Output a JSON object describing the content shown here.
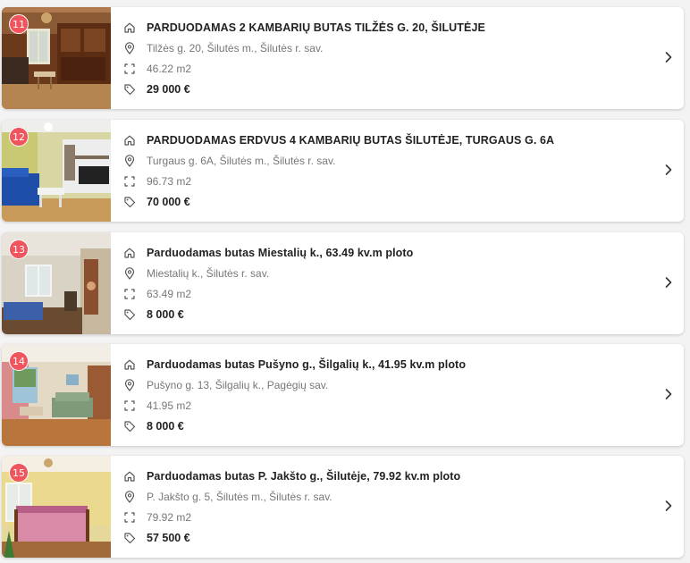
{
  "listings": [
    {
      "number": "11",
      "title": "PARDUODAMAS 2 KAMBARIŲ BUTAS TILŽĖS G. 20, ŠILUTĖJE",
      "address": "Tilžės g. 20, Šilutės m., Šilutės r. sav.",
      "area": "46.22 m2",
      "price": "29 000  €"
    },
    {
      "number": "12",
      "title": "PARDUODAMAS ERDVUS 4 KAMBARIŲ BUTAS ŠILUTĖJE, TURGAUS G. 6A",
      "address": "Turgaus g. 6A, Šilutės m., Šilutės r. sav.",
      "area": "96.73 m2",
      "price": "70 000  €"
    },
    {
      "number": "13",
      "title": "Parduodamas butas Miestalių k., 63.49 kv.m ploto",
      "address": "Miestalių k., Šilutės r. sav.",
      "area": "63.49 m2",
      "price": "8 000  €"
    },
    {
      "number": "14",
      "title": "Parduodamas butas Pušyno g., Šilgalių k., 41.95 kv.m ploto",
      "address": "Pušyno g. 13, Šilgalių k., Pagėgių sav.",
      "area": "41.95 m2",
      "price": "8 000  €"
    },
    {
      "number": "15",
      "title": "Parduodamas butas P. Jakšto g., Šilutėje, 79.92 kv.m ploto",
      "address": "P. Jakšto g. 5, Šilutės m., Šilutės r. sav.",
      "area": "79.92 m2",
      "price": "57 500  €"
    }
  ],
  "colors": {
    "badge": "#f0555e",
    "title": "#222222",
    "muted": "#777777",
    "icon": "#555555"
  },
  "icons": {
    "title": "home-icon",
    "address": "location-pin-icon",
    "area": "area-corners-icon",
    "price": "price-tag-icon",
    "open": "chevron-right-icon"
  }
}
